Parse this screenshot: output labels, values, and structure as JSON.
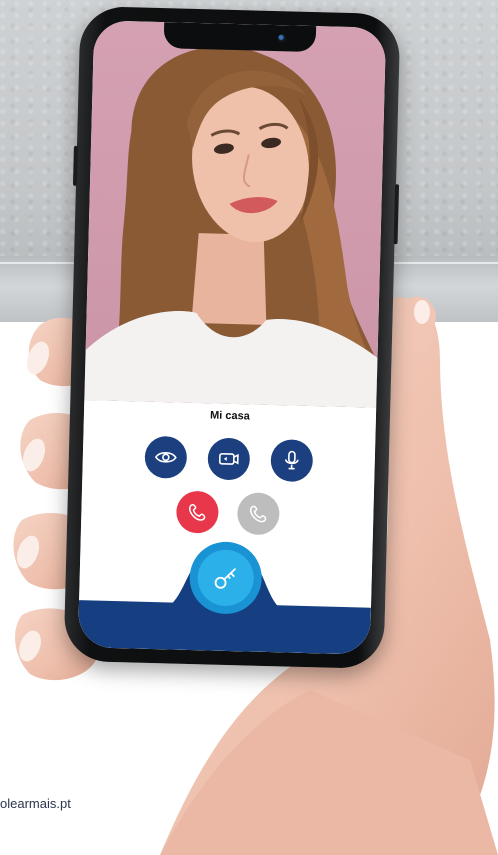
{
  "screen": {
    "location_title": "Mi casa"
  },
  "buttons": [
    {
      "name": "view-button",
      "icon": "eye-icon",
      "color": "#1c3f7f"
    },
    {
      "name": "switch-camera-button",
      "icon": "camera-switch-icon",
      "color": "#1c3f7f"
    },
    {
      "name": "microphone-button",
      "icon": "microphone-icon",
      "color": "#1c3f7f"
    },
    {
      "name": "hang-up-button",
      "icon": "phone-hangup-icon",
      "color": "#e8364a"
    },
    {
      "name": "answer-button",
      "icon": "phone-icon",
      "color": "#bdbdbd"
    },
    {
      "name": "unlock-button",
      "icon": "key-icon",
      "color": "#2cb0ea"
    }
  ],
  "navigation": {
    "back_symbol": "‹"
  },
  "footer": {
    "watermark": "olearmais.pt"
  },
  "colors": {
    "brand_blue": "#163f82",
    "accent_light_blue": "#2cb0ea",
    "video_background": "#d4a1b2"
  }
}
